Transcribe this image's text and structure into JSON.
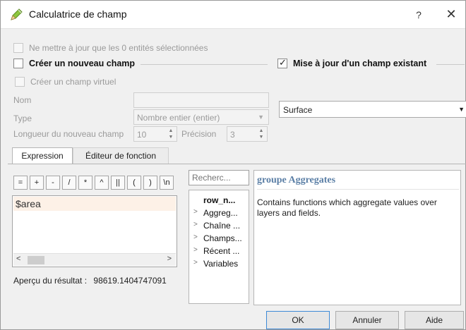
{
  "window": {
    "title": "Calculatrice de champ",
    "help_label": "?",
    "close_label": "✕"
  },
  "options": {
    "only_selected": "Ne mettre à jour que les 0 entités sélectionnées",
    "create_new_field": "Créer un nouveau champ",
    "update_existing_field": "Mise à jour d'un champ existant",
    "create_virtual_field": "Créer un champ virtuel"
  },
  "new_field": {
    "name_label": "Nom",
    "name_value": "",
    "type_label": "Type",
    "type_value": "Nombre entier (entier)",
    "length_label": "Longueur du nouveau champ",
    "length_value": "10",
    "precision_label": "Précision",
    "precision_value": "3"
  },
  "existing_field": {
    "selected": "Surface"
  },
  "tabs": [
    {
      "label": "Expression",
      "active": true
    },
    {
      "label": "Éditeur de fonction",
      "active": false
    }
  ],
  "operators": [
    "=",
    "+",
    "-",
    "/",
    "*",
    "^",
    "||",
    "(",
    ")",
    "\\n"
  ],
  "expression": {
    "text": "$area"
  },
  "function_list": {
    "search_placeholder": "Recherc...",
    "items": [
      {
        "label": "row_n...",
        "bold": true,
        "expandable": false
      },
      {
        "label": "Aggreg...",
        "bold": false,
        "expandable": true
      },
      {
        "label": "Chaîne ...",
        "bold": false,
        "expandable": true
      },
      {
        "label": "Champs...",
        "bold": false,
        "expandable": true
      },
      {
        "label": "Récent ...",
        "bold": false,
        "expandable": true
      },
      {
        "label": "Variables",
        "bold": false,
        "expandable": true
      }
    ]
  },
  "help": {
    "title": "groupe Aggregates",
    "description": "Contains functions which aggregate values over layers and fields."
  },
  "preview": {
    "label": "Aperçu du résultat :",
    "value": "98619.1404747091"
  },
  "buttons": {
    "ok": "OK",
    "cancel": "Annuler",
    "help": "Aide"
  },
  "colors": {
    "help_title": "#5b7fa6",
    "default_button_border": "#3d8ad7",
    "editor_line_highlight": "#fdf1e7"
  }
}
